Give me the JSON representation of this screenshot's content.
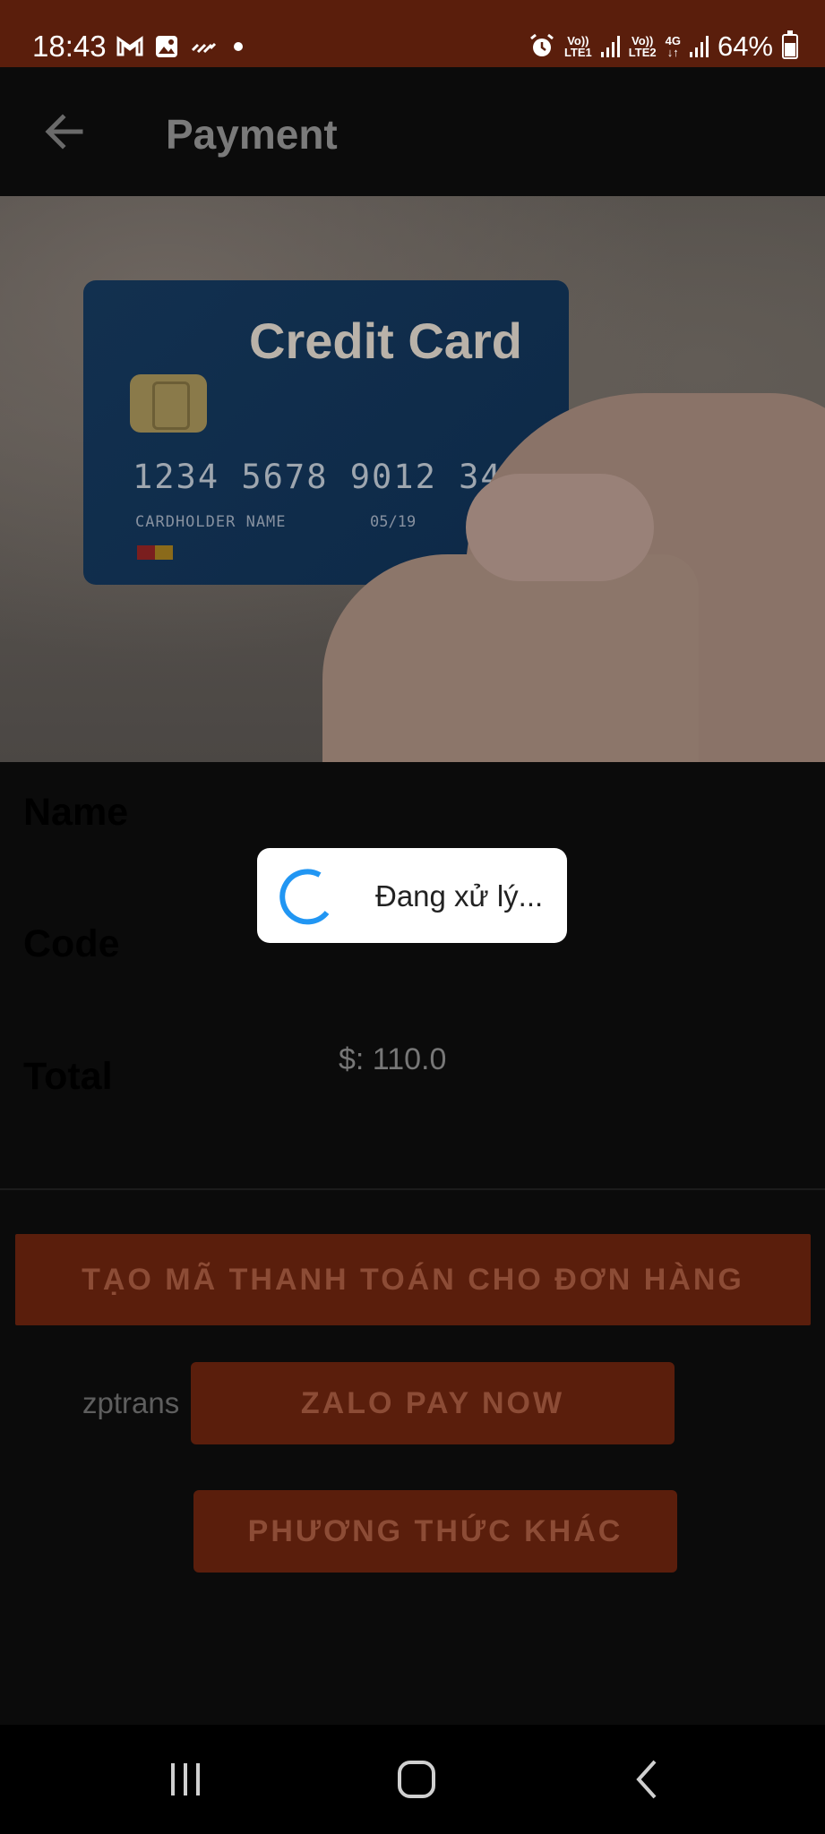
{
  "status_bar": {
    "time": "18:43",
    "lte1_top": "Vo))",
    "lte1_bottom": "LTE1",
    "lte2_top": "Vo))",
    "lte2_bottom": "LTE2",
    "network_type": "4G",
    "battery": "64%"
  },
  "app_bar": {
    "title": "Payment"
  },
  "hero": {
    "card_title": "Credit Card",
    "card_number": "1234 5678 9012 345",
    "card_holder": "CARDHOLDER NAME",
    "card_expiry": "05/19"
  },
  "form": {
    "name_label": "Name",
    "code_label": "Code",
    "total_label": "Total",
    "total_value": "$: 110.0"
  },
  "buttons": {
    "create_code": "TẠO MÃ THANH TOÁN CHO ĐƠN HÀNG",
    "zalo_pay": "ZALO PAY NOW",
    "other_method": "PHƯƠNG THỨC KHÁC"
  },
  "zp_trans_label": "zptrans",
  "dialog": {
    "message": "Đang xử lý..."
  },
  "colors": {
    "status_bar": "#5a1e0c",
    "button_bg": "#5a1e0c",
    "spinner": "#2196f3"
  }
}
